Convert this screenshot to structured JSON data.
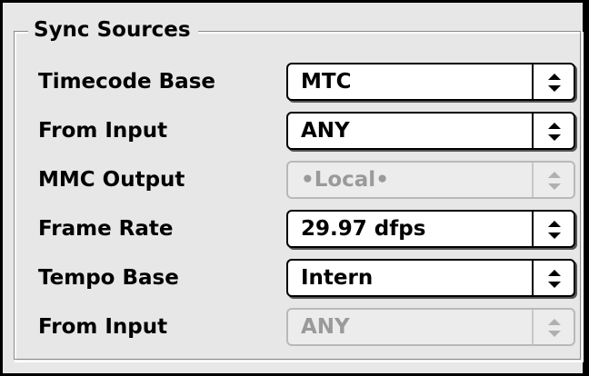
{
  "group": {
    "title": "Sync Sources"
  },
  "rows": [
    {
      "label": "Timecode Base",
      "value": "MTC",
      "enabled": true
    },
    {
      "label": "From Input",
      "value": "ANY",
      "enabled": true
    },
    {
      "label": "MMC Output",
      "value": "•Local•",
      "enabled": false
    },
    {
      "label": "Frame Rate",
      "value": "29.97 dfps",
      "enabled": true
    },
    {
      "label": "Tempo Base",
      "value": "Intern",
      "enabled": true
    },
    {
      "label": "From Input",
      "value": "ANY",
      "enabled": false
    }
  ],
  "icons": {
    "popup_arrows": "up-down-arrows-icon"
  },
  "colors": {
    "background": "#e7e7e7",
    "frame": "#000000",
    "disabled_text": "#9a9a9a"
  }
}
